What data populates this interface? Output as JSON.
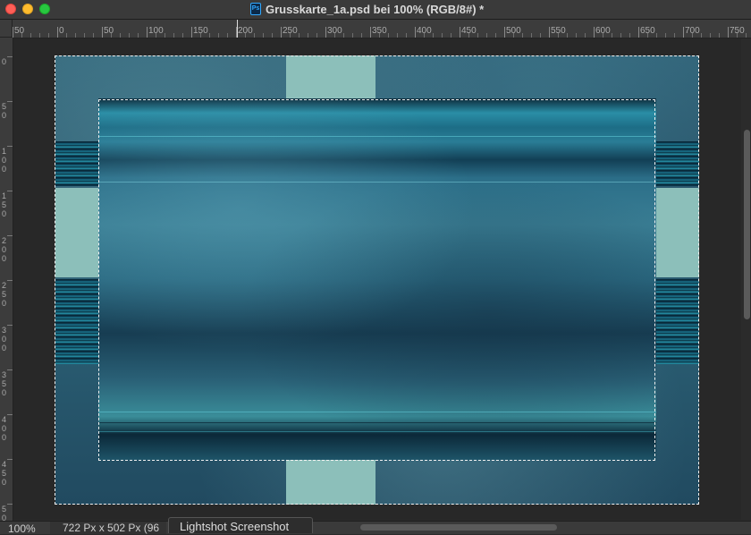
{
  "window": {
    "title": "Grusskarte_1a.psd bei 100% (RGB/8#) *",
    "app_icon": "photoshop-icon",
    "app_icon_text": "Ps"
  },
  "ruler_top": {
    "labels": [
      "50",
      "0",
      "50",
      "100",
      "150",
      "200",
      "250",
      "300",
      "350",
      "400",
      "450",
      "500",
      "550",
      "600",
      "650",
      "700",
      "750"
    ]
  },
  "ruler_left": {
    "labels": [
      [
        "0"
      ],
      [
        "5",
        "0"
      ],
      [
        "1",
        "0",
        "0"
      ],
      [
        "1",
        "5",
        "0"
      ],
      [
        "2",
        "0",
        "0"
      ],
      [
        "2",
        "5",
        "0"
      ],
      [
        "3",
        "0",
        "0"
      ],
      [
        "3",
        "5",
        "0"
      ],
      [
        "4",
        "0",
        "0"
      ],
      [
        "4",
        "5",
        "0"
      ],
      [
        "5",
        "0"
      ]
    ]
  },
  "status": {
    "zoom": "100%",
    "doc_size": "722 Px x 502 Px (96",
    "tooltip": "Lightshot Screenshot"
  },
  "colors": {
    "mint_panel": "#8cbfba",
    "teal_dark": "#244d63",
    "close": "#fe5f57",
    "minimize": "#febc2e",
    "maximize": "#28c840"
  }
}
